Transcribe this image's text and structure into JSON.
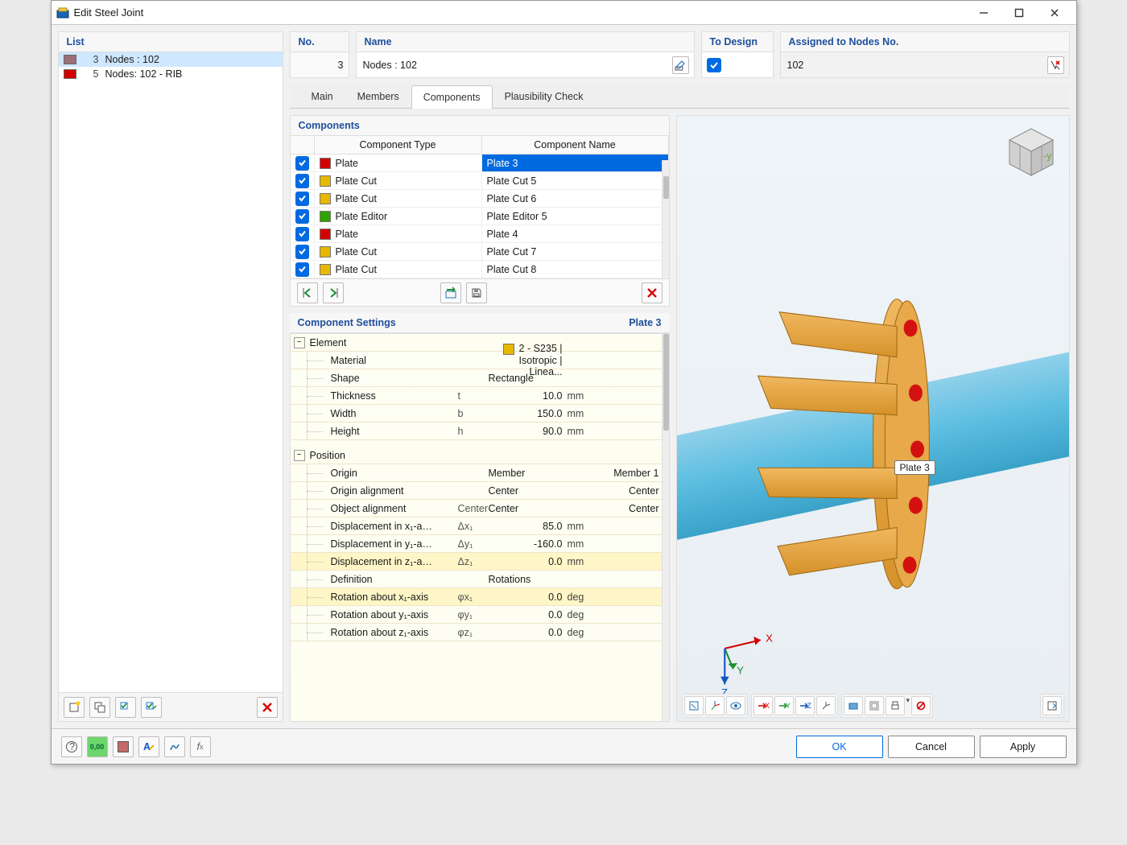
{
  "window": {
    "title": "Edit Steel Joint"
  },
  "left": {
    "header": "List",
    "items": [
      {
        "color": "#9a6f7a",
        "no": "3",
        "label": "Nodes : 102",
        "selected": true
      },
      {
        "color": "#d40000",
        "no": "5",
        "label": "Nodes: 102 - RIB",
        "selected": false
      }
    ]
  },
  "top": {
    "no_label": "No.",
    "no_value": "3",
    "name_label": "Name",
    "name_value": "Nodes : 102",
    "design_label": "To Design",
    "design_checked": true,
    "nodes_label": "Assigned to Nodes No.",
    "nodes_value": "102"
  },
  "tabs": [
    "Main",
    "Members",
    "Components",
    "Plausibility Check"
  ],
  "active_tab": 2,
  "components": {
    "header": "Components",
    "col_type": "Component Type",
    "col_name": "Component Name",
    "rows": [
      {
        "chk": true,
        "color": "#d40000",
        "type": "Plate",
        "name": "Plate 3",
        "selected": true
      },
      {
        "chk": true,
        "color": "#e6b800",
        "type": "Plate Cut",
        "name": "Plate Cut 5"
      },
      {
        "chk": true,
        "color": "#e6b800",
        "type": "Plate Cut",
        "name": "Plate Cut 6"
      },
      {
        "chk": true,
        "color": "#2fa300",
        "type": "Plate Editor",
        "name": "Plate Editor 5"
      },
      {
        "chk": true,
        "color": "#d40000",
        "type": "Plate",
        "name": "Plate 4"
      },
      {
        "chk": true,
        "color": "#e6b800",
        "type": "Plate Cut",
        "name": "Plate Cut 7"
      },
      {
        "chk": true,
        "color": "#e6b800",
        "type": "Plate Cut",
        "name": "Plate Cut 8"
      }
    ]
  },
  "settings": {
    "header": "Component Settings",
    "plate": "Plate 3",
    "groups": [
      {
        "name": "Element",
        "rows": [
          {
            "label": "Material",
            "sym": "",
            "val": "2 - S235 | Isotropic | Linea...",
            "unit": "",
            "swatch": "#e6b800"
          },
          {
            "label": "Shape",
            "sym": "",
            "val": "Rectangle",
            "unit": ""
          },
          {
            "label": "Thickness",
            "sym": "t",
            "val": "10.0",
            "unit": "mm"
          },
          {
            "label": "Width",
            "sym": "b",
            "val": "150.0",
            "unit": "mm"
          },
          {
            "label": "Height",
            "sym": "h",
            "val": "90.0",
            "unit": "mm"
          }
        ]
      },
      {
        "name": "Position",
        "rows": [
          {
            "label": "Origin",
            "sym": "",
            "val": "Member",
            "unit": "",
            "xtra": "Member 1"
          },
          {
            "label": "Origin alignment",
            "sym": "",
            "val": "Center",
            "unit": "",
            "xtra": "Center"
          },
          {
            "label": "Object alignment",
            "sym": "",
            "val2": "Center",
            "val": "Center",
            "unit": "",
            "xtra": "Center"
          },
          {
            "label": "Displacement in x₁-a…",
            "sym": "Δx₁",
            "val": "85.0",
            "unit": "mm"
          },
          {
            "label": "Displacement in y₁-a…",
            "sym": "Δy₁",
            "val": "-160.0",
            "unit": "mm"
          },
          {
            "label": "Displacement in z₁-a…",
            "sym": "Δz₁",
            "val": "0.0",
            "unit": "mm",
            "hl": true
          },
          {
            "label": "Definition",
            "sym": "",
            "val": "Rotations",
            "unit": ""
          },
          {
            "label": "Rotation about x₁-axis",
            "sym": "φx₁",
            "val": "0.0",
            "unit": "deg",
            "hl": true
          },
          {
            "label": "Rotation about y₁-axis",
            "sym": "φy₁",
            "val": "0.0",
            "unit": "deg"
          },
          {
            "label": "Rotation about z₁-axis",
            "sym": "φz₁",
            "val": "0.0",
            "unit": "deg"
          }
        ]
      }
    ]
  },
  "view": {
    "tooltip": "Plate 3"
  },
  "footer": {
    "ok": "OK",
    "cancel": "Cancel",
    "apply": "Apply"
  }
}
